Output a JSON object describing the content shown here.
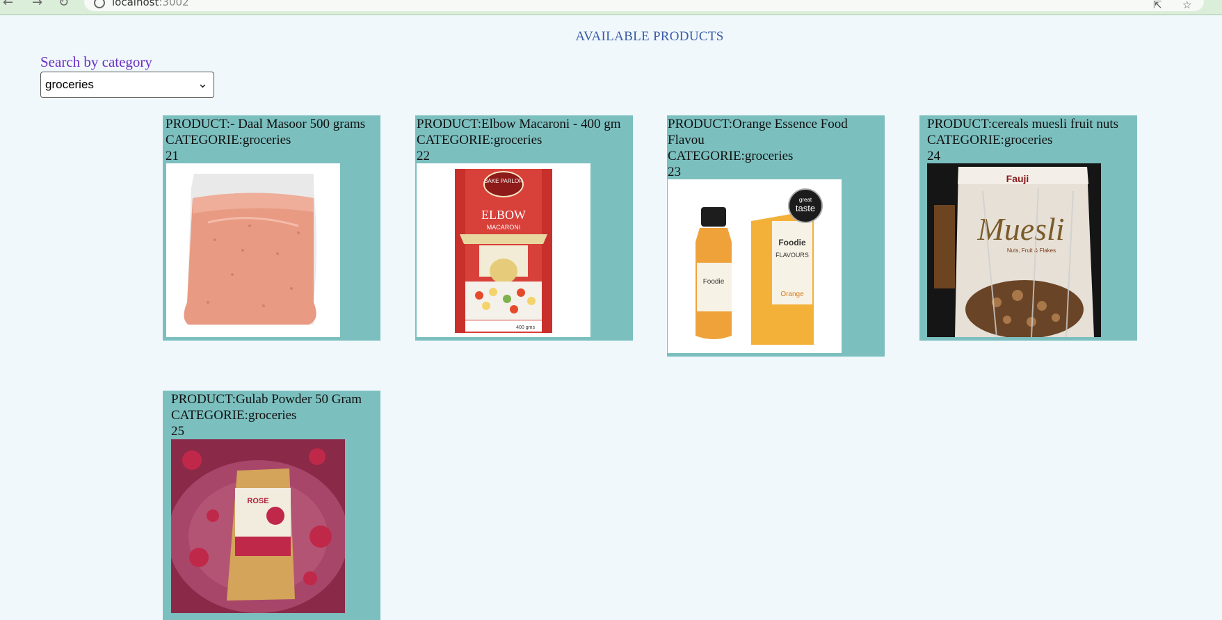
{
  "browser": {
    "url_host": "localhost",
    "url_port": ":3002"
  },
  "page": {
    "title": "AVAILABLE PRODUCTS",
    "search_label": "Search by category",
    "category_value": "groceries"
  },
  "products": [
    {
      "product_line": "PRODUCT:- Daal Masoor 500 grams",
      "category_line": "CATEGORIE:groceries",
      "id": "21",
      "image": "red-lentil-bag"
    },
    {
      "product_line": "PRODUCT:Elbow Macaroni - 400 gm",
      "category_line": "CATEGORIE:groceries",
      "id": "22",
      "image": "macaroni-box"
    },
    {
      "product_line": "PRODUCT:Orange Essence Food Flavou",
      "category_line": "CATEGORIE:groceries",
      "id": "23",
      "image": "orange-flavour-bottle"
    },
    {
      "product_line": "PRODUCT:cereals muesli fruit nuts",
      "category_line": "CATEGORIE:groceries",
      "id": "24",
      "image": "muesli-pack"
    },
    {
      "product_line": "PRODUCT:Gulab Powder 50 Gram",
      "category_line": "CATEGORIE:groceries",
      "id": "25",
      "image": "rose-powder-pack"
    }
  ],
  "images": {
    "macaroni_brand": "BAKE PARLOR",
    "macaroni_title": "ELBOW",
    "macaroni_sub": "MACARONI",
    "macaroni_weight": "400 gms",
    "flavour_brand": "Foodie FLAVOURS",
    "flavour_badge_top": "great",
    "flavour_badge": "taste",
    "flavour_name": "Orange",
    "muesli_brand": "Fauji",
    "muesli_title": "Muesli",
    "muesli_sub": "Nuts, Fruit & Flakes",
    "rose_title": "ROSE"
  }
}
